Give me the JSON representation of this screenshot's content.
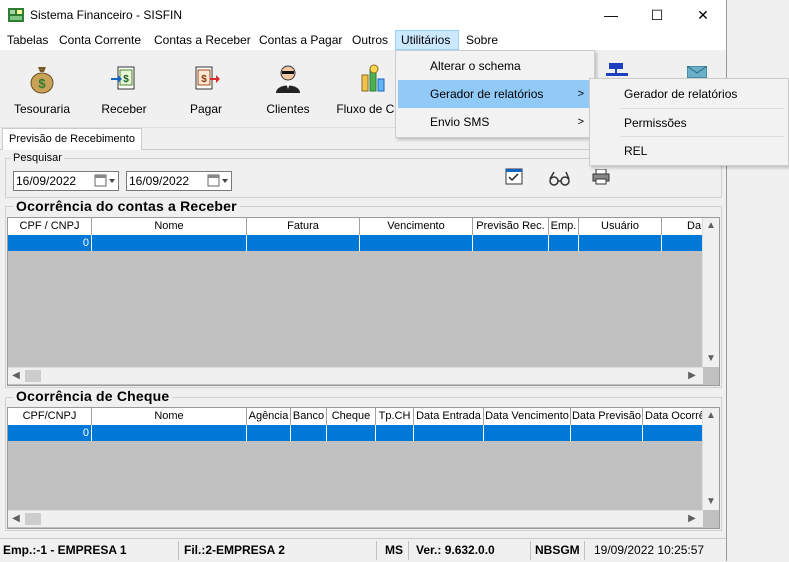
{
  "window": {
    "title": "Sistema Financeiro - SISFIN",
    "minimize_glyph": "—",
    "maximize_glyph": "☐",
    "close_glyph": "✕"
  },
  "menubar": [
    "Tabelas",
    "Conta Corrente",
    "Contas a Receber",
    "Contas a Pagar",
    "Outros",
    "Utilitários",
    "Sobre"
  ],
  "toolbar": [
    "Tesouraria",
    "Receber",
    "Pagar",
    "Clientes",
    "Fluxo de Cai"
  ],
  "tab": "Previsão de Recebimento",
  "search": {
    "label": "Pesquisar",
    "date_from": "16/09/2022",
    "date_to": "16/09/2022"
  },
  "grid1": {
    "title": "Ocorrência do contas a Receber",
    "columns": [
      "CPF / CNPJ",
      "Nome",
      "Fatura",
      "Vencimento",
      "Previsão Rec.",
      "Emp.",
      "Usuário",
      "Da"
    ],
    "first_cell": "0"
  },
  "grid2": {
    "title": "Ocorrência de Cheque",
    "columns": [
      "CPF/CNPJ",
      "Nome",
      "Agência",
      "Banco",
      "Cheque",
      "Tp.CH",
      "Data Entrada",
      "Data Vencimento",
      "Data Previsão",
      "Data Ocorrê"
    ],
    "first_cell": "0"
  },
  "status": {
    "emp": "Emp.:-1 - EMPRESA 1",
    "fil": "Fil.:2-EMPRESA 2",
    "ms": "MS",
    "ver": "Ver.: 9.632.0.0",
    "user": "NBSGM",
    "datetime": "19/09/2022 10:25:57"
  },
  "utilitarios_menu": [
    {
      "label": "Alterar o schema",
      "submenu": false
    },
    {
      "label": "Gerador de relatórios",
      "submenu": true
    },
    {
      "label": "Envio SMS",
      "submenu": true
    }
  ],
  "submenu": [
    "Gerador de relatórios",
    "Permissões",
    "REL"
  ],
  "colors": {
    "selection": "#0078d7",
    "menu_highlight": "#91c9f7",
    "grid_bg": "#c0c0c0"
  }
}
